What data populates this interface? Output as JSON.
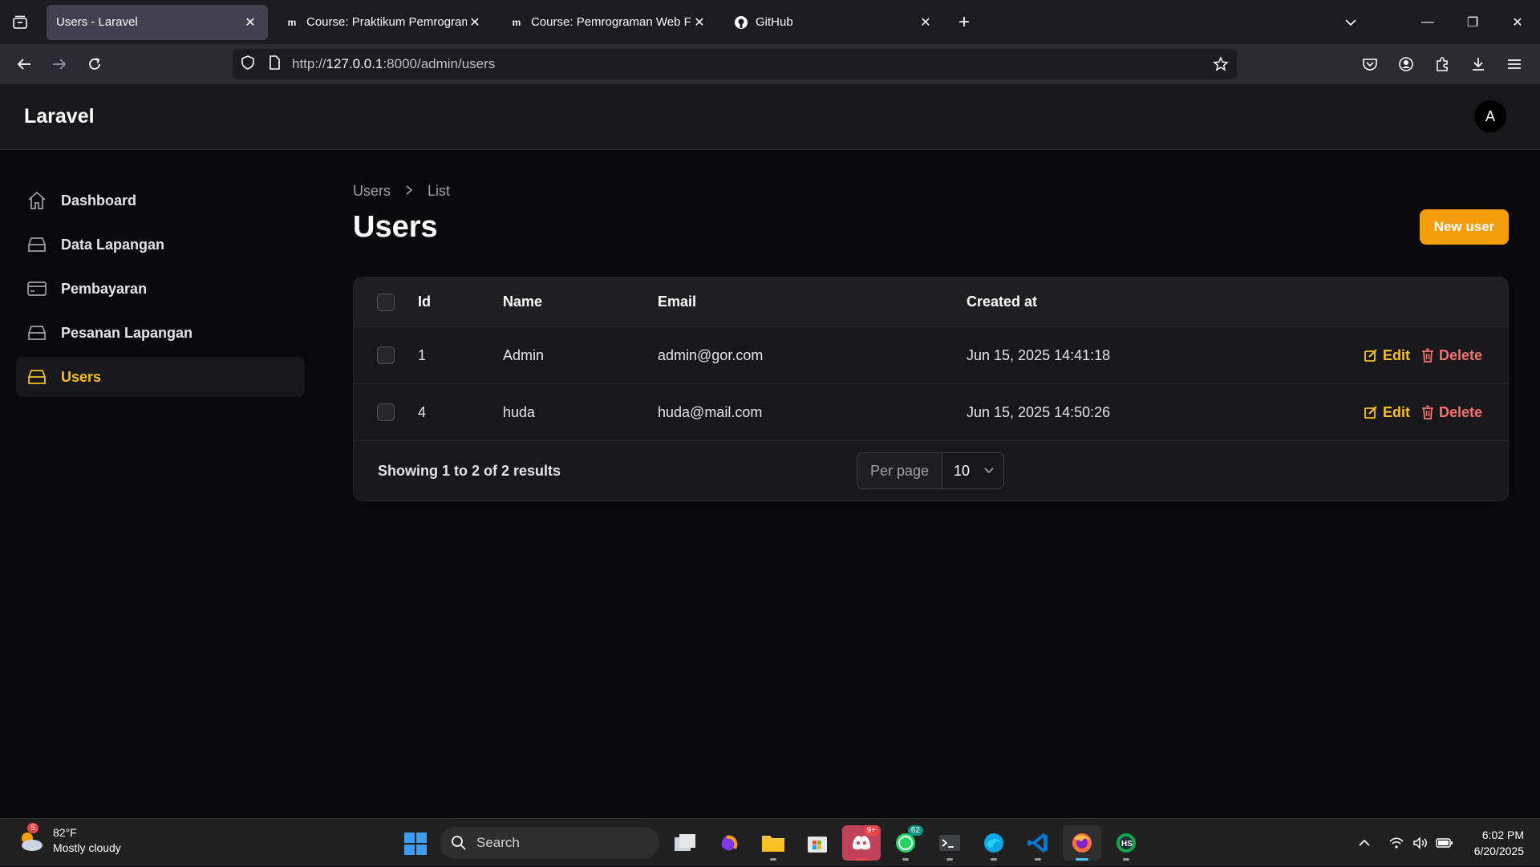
{
  "browser": {
    "tabs": [
      {
        "label": "Users - Laravel",
        "active": true
      },
      {
        "label": "Course: Praktikum Pemrograma",
        "active": false
      },
      {
        "label": "Course: Pemrograman Web Frar",
        "active": false
      },
      {
        "label": "GitHub",
        "active": false
      }
    ],
    "url_prefix": "http://",
    "url_host": "127.0.0.1",
    "url_rest": ":8000/admin/users"
  },
  "app": {
    "brand": "Laravel",
    "avatar_initial": "A"
  },
  "sidebar": {
    "items": [
      {
        "label": "Dashboard",
        "icon": "home-icon"
      },
      {
        "label": "Data Lapangan",
        "icon": "inbox-icon"
      },
      {
        "label": "Pembayaran",
        "icon": "credit-card-icon"
      },
      {
        "label": "Pesanan Lapangan",
        "icon": "inbox-icon"
      },
      {
        "label": "Users",
        "icon": "inbox-icon",
        "active": true
      }
    ]
  },
  "main": {
    "breadcrumb": [
      "Users",
      "List"
    ],
    "title": "Users",
    "new_button": "New user",
    "columns": [
      "Id",
      "Name",
      "Email",
      "Created at"
    ],
    "rows": [
      {
        "id": "1",
        "name": "Admin",
        "email": "admin@gor.com",
        "created_at": "Jun 15, 2025 14:41:18"
      },
      {
        "id": "4",
        "name": "huda",
        "email": "huda@mail.com",
        "created_at": "Jun 15, 2025 14:50:26"
      }
    ],
    "edit_label": "Edit",
    "delete_label": "Delete",
    "showing": "Showing 1 to 2 of 2 results",
    "per_page_label": "Per page",
    "per_page_value": "10"
  },
  "taskbar": {
    "weather_badge": "5",
    "temperature": "82°F",
    "condition": "Mostly cloudy",
    "search_placeholder": "Search",
    "discord_badge": "9+",
    "whatsapp_badge": "62",
    "time": "6:02 PM",
    "date": "6/20/2025"
  },
  "colors": {
    "accent": "#f59e0b",
    "danger": "#f87171",
    "background": "#09090b"
  }
}
